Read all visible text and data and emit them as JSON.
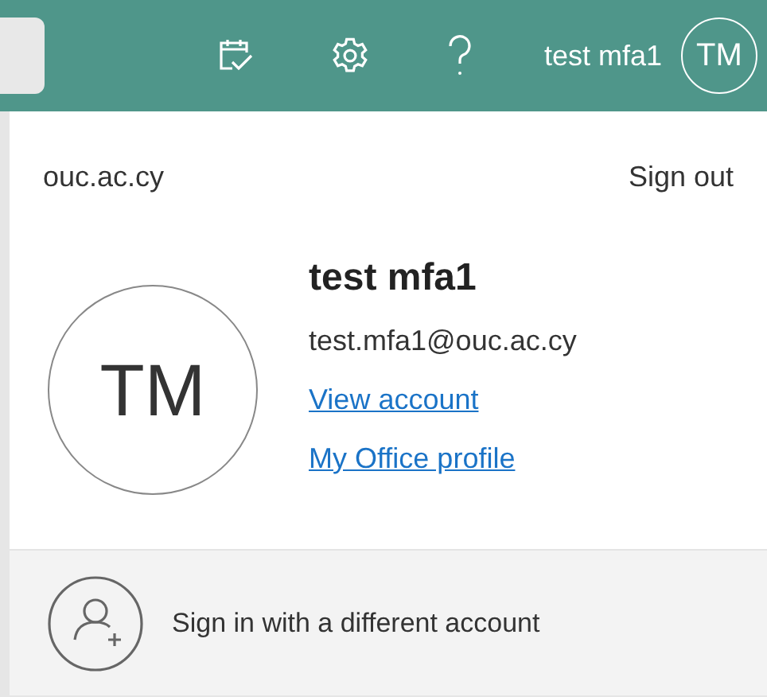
{
  "header": {
    "user_name": "test mfa1",
    "avatar_initials": "TM"
  },
  "panel": {
    "organization": "ouc.ac.cy",
    "sign_out": "Sign out",
    "display_name": "test mfa1",
    "avatar_initials": "TM",
    "email": "test.mfa1@ouc.ac.cy",
    "links": [
      "View account",
      "My Office profile"
    ],
    "other_account": "Sign in with a different account"
  }
}
